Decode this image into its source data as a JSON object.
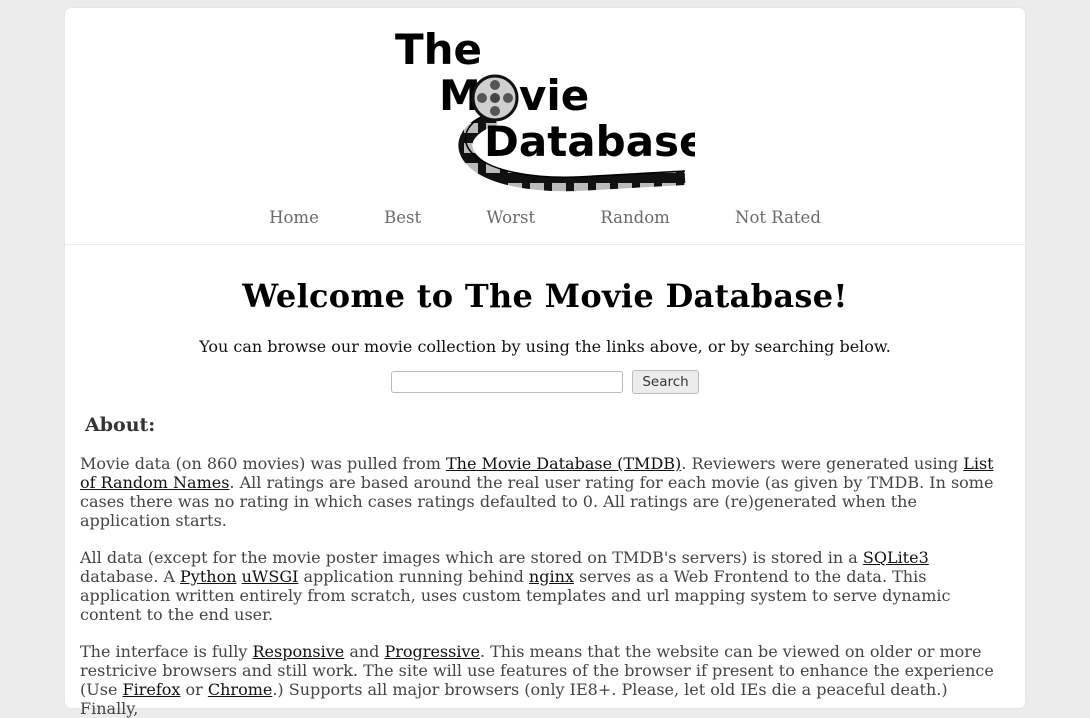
{
  "logo": {
    "line1": "The",
    "line2_prefix": "M",
    "line2_suffix": "vie",
    "line3": "Database"
  },
  "nav": [
    "Home",
    "Best",
    "Worst",
    "Random",
    "Not Rated"
  ],
  "welcome": {
    "title": "Welcome to The Movie Database!",
    "intro": "You can browse our movie collection by using the links above, or by searching below."
  },
  "search": {
    "value": "",
    "button_label": "Search"
  },
  "about": {
    "heading": "About:",
    "p1": {
      "t1": "Movie data (on 860 movies) was pulled from ",
      "link1": "The Movie Database (TMDB)",
      "t2": ". Reviewers were generated using ",
      "link2": "List of Random Names",
      "t3": ". All ratings are based around the real user rating for each movie (as given by TMDB. In some cases there was no rating in which cases ratings defaulted to 0. All ratings are (re)generated when the application starts."
    },
    "p2": {
      "t1": "All data (except for the movie poster images which are stored on TMDB's servers) is stored in a ",
      "link1": "SQLite3",
      "t2": " database. A ",
      "link2": "Python",
      "t3": " ",
      "link3": "uWSGI",
      "t4": " application running behind ",
      "link4": "nginx",
      "t5": " serves as a Web Frontend to the data. This application written entirely from scratch, uses custom templates and url mapping system to serve dynamic content to the end user."
    },
    "p3": {
      "t1": "The interface is fully ",
      "link1": "Responsive",
      "t2": " and ",
      "link2": "Progressive",
      "t3": ". This means that the website can be viewed on older or more restricive browsers and still work. The site will use features of the browser if present to enhance the experience (Use ",
      "link3": "Firefox",
      "t4": " or ",
      "link4": "Chrome",
      "t5": ".) Supports all major browsers (only IE8+. Please, let old IEs die a peaceful death.) Finally,"
    }
  }
}
